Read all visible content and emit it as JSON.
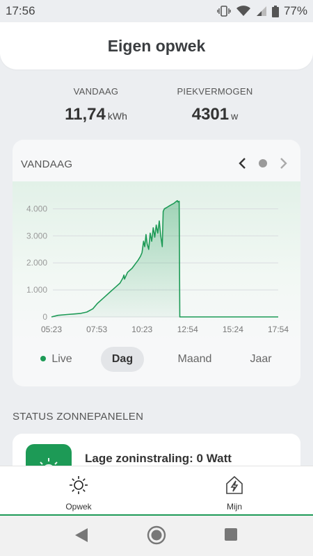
{
  "status_bar": {
    "time": "17:56",
    "battery": "77%"
  },
  "header": {
    "title": "Eigen opwek"
  },
  "stats": {
    "today": {
      "label": "VANDAAG",
      "value": "11,74",
      "unit": "kWh"
    },
    "peak": {
      "label": "PIEKVERMOGEN",
      "value": "4301",
      "unit": "w"
    }
  },
  "chart_card": {
    "title": "VANDAAG"
  },
  "chart_data": {
    "type": "area",
    "x_ticks": [
      "05:23",
      "07:53",
      "10:23",
      "12:54",
      "15:24",
      "17:54"
    ],
    "y_ticks": [
      "0",
      "1.000",
      "2.000",
      "3.000",
      "4.000"
    ],
    "ylim": [
      0,
      4500
    ],
    "x_minutes_range": [
      "05:23",
      "17:54"
    ],
    "series": [
      {
        "color": "#1d9a56",
        "points": [
          [
            "05:23",
            0
          ],
          [
            "05:45",
            60
          ],
          [
            "06:15",
            90
          ],
          [
            "06:40",
            110
          ],
          [
            "07:00",
            130
          ],
          [
            "07:20",
            180
          ],
          [
            "07:40",
            300
          ],
          [
            "07:55",
            500
          ],
          [
            "08:15",
            700
          ],
          [
            "08:35",
            900
          ],
          [
            "08:55",
            1100
          ],
          [
            "09:10",
            1250
          ],
          [
            "09:20",
            1450
          ],
          [
            "09:23",
            1550
          ],
          [
            "09:25",
            1400
          ],
          [
            "09:35",
            1650
          ],
          [
            "09:50",
            1800
          ],
          [
            "10:00",
            1950
          ],
          [
            "10:10",
            2100
          ],
          [
            "10:18",
            2250
          ],
          [
            "10:23",
            2380
          ],
          [
            "10:28",
            2800
          ],
          [
            "10:32",
            2600
          ],
          [
            "10:36",
            3050
          ],
          [
            "10:40",
            2700
          ],
          [
            "10:45",
            2500
          ],
          [
            "10:50",
            3100
          ],
          [
            "10:55",
            2800
          ],
          [
            "11:00",
            3300
          ],
          [
            "11:05",
            2950
          ],
          [
            "11:10",
            3400
          ],
          [
            "11:15",
            3100
          ],
          [
            "11:20",
            3550
          ],
          [
            "11:25",
            3000
          ],
          [
            "11:30",
            2600
          ],
          [
            "11:33",
            3900
          ],
          [
            "11:37",
            4000
          ],
          [
            "11:45",
            4050
          ],
          [
            "11:52",
            4100
          ],
          [
            "12:00",
            4150
          ],
          [
            "12:08",
            4200
          ],
          [
            "12:15",
            4260
          ],
          [
            "12:20",
            4301
          ],
          [
            "12:22",
            4250
          ],
          [
            "12:26",
            4280
          ],
          [
            "12:28",
            0
          ],
          [
            "17:54",
            0
          ]
        ]
      }
    ],
    "grid": true
  },
  "tabs": [
    {
      "label": "Live",
      "color": "#1d9a56"
    },
    {
      "label": "Dag"
    },
    {
      "label": "Maand"
    },
    {
      "label": "Jaar"
    }
  ],
  "status_section": {
    "title": "STATUS ZONNEPANELEN",
    "message": "Lage zoninstraling: 0 Watt"
  },
  "bottom_nav": [
    {
      "label": "Opwek",
      "icon": "sun-icon"
    },
    {
      "label": "Mijn",
      "icon": "house-lightning-icon"
    }
  ],
  "colors": {
    "accent": "#1d9a56"
  }
}
